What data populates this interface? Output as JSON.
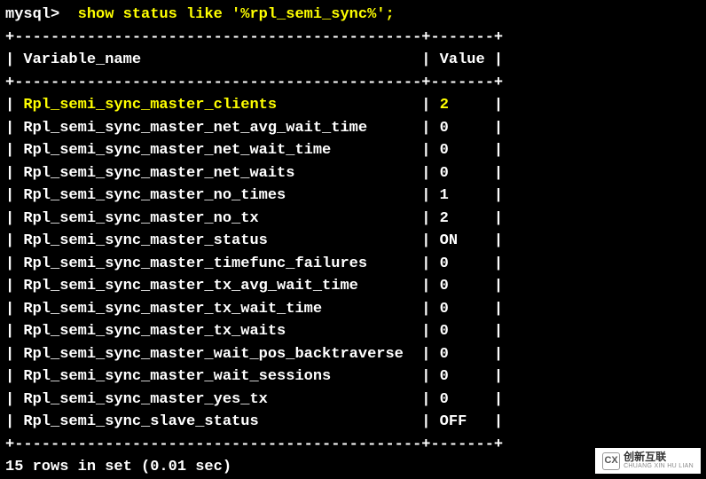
{
  "prompt": "mysql> ",
  "command": " show status like '%rpl_semi_sync%';",
  "divider": "+---------------------------------------------+-------+",
  "header": {
    "col1": "Variable_name",
    "col2": "Value"
  },
  "rows": [
    {
      "name": "Rpl_semi_sync_master_clients",
      "value": "2",
      "highlight": true
    },
    {
      "name": "Rpl_semi_sync_master_net_avg_wait_time",
      "value": "0",
      "highlight": false
    },
    {
      "name": "Rpl_semi_sync_master_net_wait_time",
      "value": "0",
      "highlight": false
    },
    {
      "name": "Rpl_semi_sync_master_net_waits",
      "value": "0",
      "highlight": false
    },
    {
      "name": "Rpl_semi_sync_master_no_times",
      "value": "1",
      "highlight": false
    },
    {
      "name": "Rpl_semi_sync_master_no_tx",
      "value": "2",
      "highlight": false
    },
    {
      "name": "Rpl_semi_sync_master_status",
      "value": "ON",
      "highlight": false
    },
    {
      "name": "Rpl_semi_sync_master_timefunc_failures",
      "value": "0",
      "highlight": false
    },
    {
      "name": "Rpl_semi_sync_master_tx_avg_wait_time",
      "value": "0",
      "highlight": false
    },
    {
      "name": "Rpl_semi_sync_master_tx_wait_time",
      "value": "0",
      "highlight": false
    },
    {
      "name": "Rpl_semi_sync_master_tx_waits",
      "value": "0",
      "highlight": false
    },
    {
      "name": "Rpl_semi_sync_master_wait_pos_backtraverse",
      "value": "0",
      "highlight": false
    },
    {
      "name": "Rpl_semi_sync_master_wait_sessions",
      "value": "0",
      "highlight": false
    },
    {
      "name": "Rpl_semi_sync_master_yes_tx",
      "value": "0",
      "highlight": false
    },
    {
      "name": "Rpl_semi_sync_slave_status",
      "value": "OFF",
      "highlight": false
    }
  ],
  "footer": "15 rows in set (0.01 sec)",
  "col1_width": 45,
  "col2_width": 7,
  "watermark": {
    "logo": "CX",
    "cn": "创新互联",
    "en": "CHUANG XIN HU LIAN"
  }
}
